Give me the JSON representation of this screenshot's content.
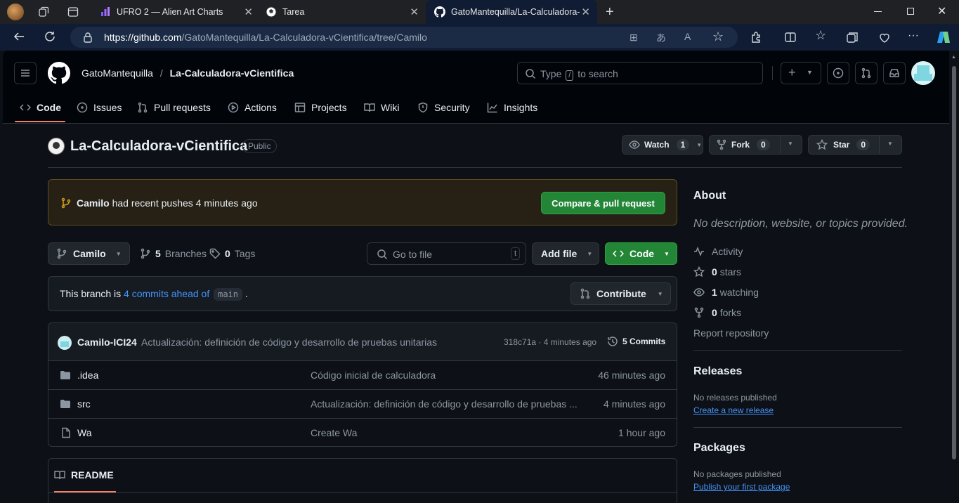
{
  "browser": {
    "tabs": [
      {
        "title": "UFRO 2 — Alien Art Charts",
        "icon": "chart-bars-icon"
      },
      {
        "title": "Tarea",
        "icon": "soccer-ball-icon"
      },
      {
        "title": "GatoMantequilla/La-Calculadora-",
        "icon": "github-icon",
        "active": true
      }
    ],
    "url_host": "https://github.com",
    "url_path": "/GatoMantequilla/La-Calculadora-vCientifica/tree/Camilo"
  },
  "header": {
    "owner": "GatoMantequilla",
    "separator": "/",
    "repo": "La-Calculadora-vCientifica",
    "search_pre": "Type",
    "search_key": "/",
    "search_post": "to search",
    "new_label": "+"
  },
  "nav": {
    "code": "Code",
    "issues": "Issues",
    "pulls": "Pull requests",
    "actions": "Actions",
    "projects": "Projects",
    "wiki": "Wiki",
    "security": "Security",
    "insights": "Insights"
  },
  "repo": {
    "name": "La-Calculadora-vCientifica",
    "visibility": "Public",
    "watch_label": "Watch",
    "watch_count": "1",
    "fork_label": "Fork",
    "fork_count": "0",
    "star_label": "Star",
    "star_count": "0"
  },
  "flash": {
    "branch": "Camilo",
    "text": "had recent pushes 4 minutes ago",
    "button": "Compare & pull request"
  },
  "toolbar": {
    "branch": "Camilo",
    "branches_count": "5",
    "branches_label": "Branches",
    "tags_count": "0",
    "tags_label": "Tags",
    "goto_placeholder": "Go to file",
    "goto_key": "t",
    "add_file": "Add file",
    "code": "Code"
  },
  "ahead": {
    "pre": "This branch is",
    "link": "4 commits ahead of",
    "base": "main",
    "post": ".",
    "contribute": "Contribute"
  },
  "commit": {
    "author": "Camilo-ICI24",
    "message": "Actualización: definición de código y desarrollo de pruebas unitarias",
    "meta": "318c71a · 4 minutes ago",
    "commits_label": "5 Commits"
  },
  "files": [
    {
      "name": ".idea",
      "type": "folder",
      "message": "Código inicial de calculadora",
      "date": "46 minutes ago"
    },
    {
      "name": "src",
      "type": "folder",
      "message": "Actualización: definición de código y desarrollo de pruebas ...",
      "date": "4 minutes ago"
    },
    {
      "name": "Wa",
      "type": "file",
      "message": "Create Wa",
      "date": "1 hour ago"
    }
  ],
  "readme": {
    "title": "README"
  },
  "about": {
    "title": "About",
    "description": "No description, website, or topics provided.",
    "activity": "Activity",
    "stars_count": "0",
    "stars_label": "stars",
    "watching_count": "1",
    "watching_label": "watching",
    "forks_count": "0",
    "forks_label": "forks",
    "report": "Report repository"
  },
  "releases": {
    "title": "Releases",
    "none": "No releases published",
    "link": "Create a new release"
  },
  "packages": {
    "title": "Packages",
    "none": "No packages published",
    "link": "Publish your first package"
  },
  "colors": {
    "accent_green": "#238636",
    "link_blue": "#4493f8",
    "tab_underline": "#f78166",
    "background": "#0d1117"
  }
}
